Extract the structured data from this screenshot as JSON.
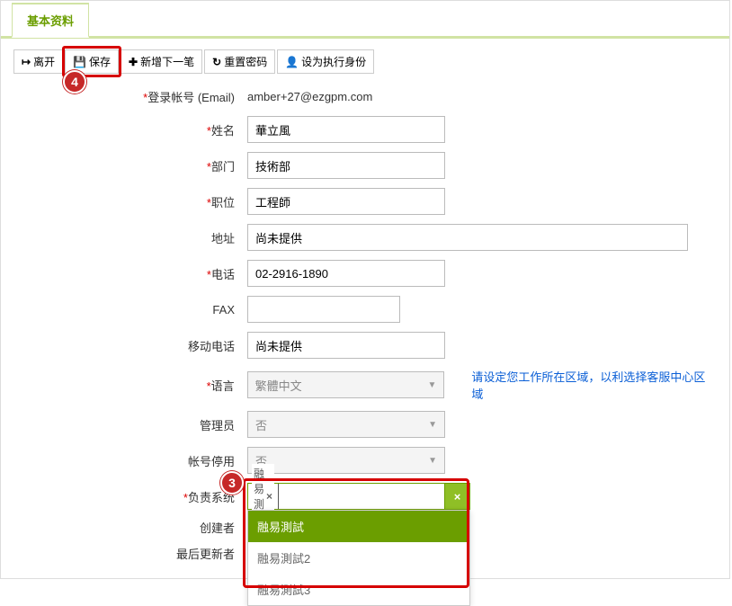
{
  "tab": {
    "basic": "基本资料"
  },
  "toolbar": {
    "leave": "离开",
    "save": "保存",
    "addnext": "新增下一笔",
    "resetpw": "重置密码",
    "setexec": "设为执行身份"
  },
  "badges": {
    "step3": "3",
    "step4": "4"
  },
  "labels": {
    "email": "登录帐号 (Email)",
    "name": "姓名",
    "dept": "部门",
    "position": "职位",
    "address": "地址",
    "phone": "电话",
    "fax": "FAX",
    "mobile": "移动电话",
    "lang": "语言",
    "admin": "管理员",
    "disabled": "帐号停用",
    "respsys": "负责系统",
    "creator": "创建者",
    "updater": "最后更新者"
  },
  "values": {
    "email": "amber+27@ezgpm.com",
    "name": "華立風",
    "dept": "技術部",
    "position": "工程師",
    "address": "尚未提供",
    "phone": "02-2916-1890",
    "fax": "",
    "mobile": "尚未提供",
    "lang": "繁體中文",
    "admin": "否",
    "disabled": "否"
  },
  "lang_hint": "请设定您工作所在区域，以利选择客服中心区域",
  "respsys": {
    "chip": "融易測試",
    "options": [
      "融易測試",
      "融易測試2",
      "融易測試3"
    ]
  }
}
